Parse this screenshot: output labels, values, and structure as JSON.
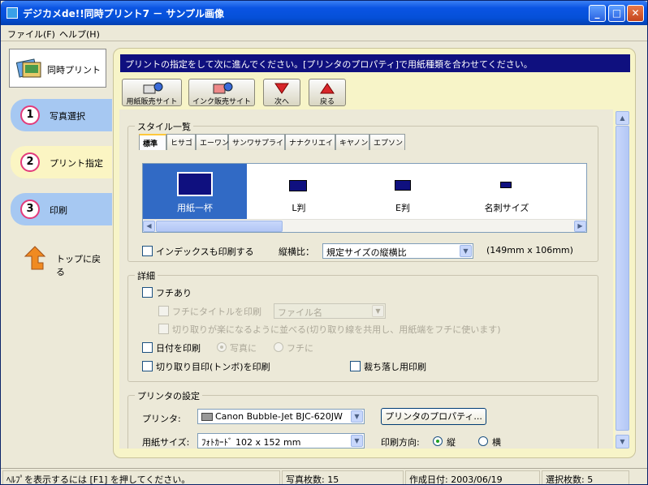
{
  "window": {
    "title": "デジカメde!!同時プリント7 － サンプル画像",
    "minimize": "_",
    "maximize": "□",
    "close": "✕"
  },
  "menu": {
    "file": "ファイル(F)",
    "help": "ヘルプ(H)"
  },
  "sidebar": {
    "top_label": "同時プリント",
    "steps": [
      {
        "num": "1",
        "label": "写真選択"
      },
      {
        "num": "2",
        "label": "プリント指定"
      },
      {
        "num": "3",
        "label": "印刷"
      }
    ],
    "back_label": "トップに戻る"
  },
  "banner": "プリントの指定をして次に進んでください。[プリンタのプロパティ]で用紙種類を合わせてください。",
  "toolbar": {
    "paper_shop": "用紙販売サイト",
    "ink_shop": "インク販売サイト",
    "next": "次へ",
    "back": "戻る"
  },
  "style_list": {
    "legend": "スタイル一覧",
    "tabs": [
      "標準",
      "ヒサゴ",
      "エーワン",
      "サンワサプライ",
      "ナナクリエイト",
      "キヤノン",
      "エプソン"
    ],
    "cards": [
      "用紙一杯",
      "L判",
      "E判",
      "名刺サイズ"
    ],
    "index_print": "インデックスも印刷する",
    "aspect_label": "縦横比：",
    "aspect_value": "規定サイズの縦横比",
    "size_note": "(149mm x 106mm)"
  },
  "details": {
    "legend": "詳細",
    "border": "フチあり",
    "title_on_border": "フチにタイトルを印刷",
    "title_combo": "ファイル名",
    "easy_cut": "切り取りが楽になるように並べる(切り取り線を共用し、用紙端をフチに使います)",
    "date_print": "日付を印刷",
    "on_photo": "写真に",
    "on_border": "フチに",
    "crop_marks": "切り取り目印(トンボ)を印刷",
    "bleed": "裁ち落し用印刷"
  },
  "printer": {
    "legend": "プリンタの設定",
    "printer_label": "プリンタ:",
    "printer_value": "Canon Bubble-Jet BJC-620JW",
    "properties_button": "プリンタのプロパティ...",
    "paper_label": "用紙サイズ:",
    "paper_value": "ﾌｫﾄｶｰﾄﾞ 102 x 152 mm",
    "orientation_label": "印刷方向:",
    "portrait": "縦",
    "landscape": "横"
  },
  "status": {
    "help": "ﾍﾙﾌﾟを表示するには [F1] を押してください。",
    "photo_count": "写真枚数: 15",
    "created": "作成日付: 2003/06/19",
    "selected": "選択枚数: 5"
  }
}
